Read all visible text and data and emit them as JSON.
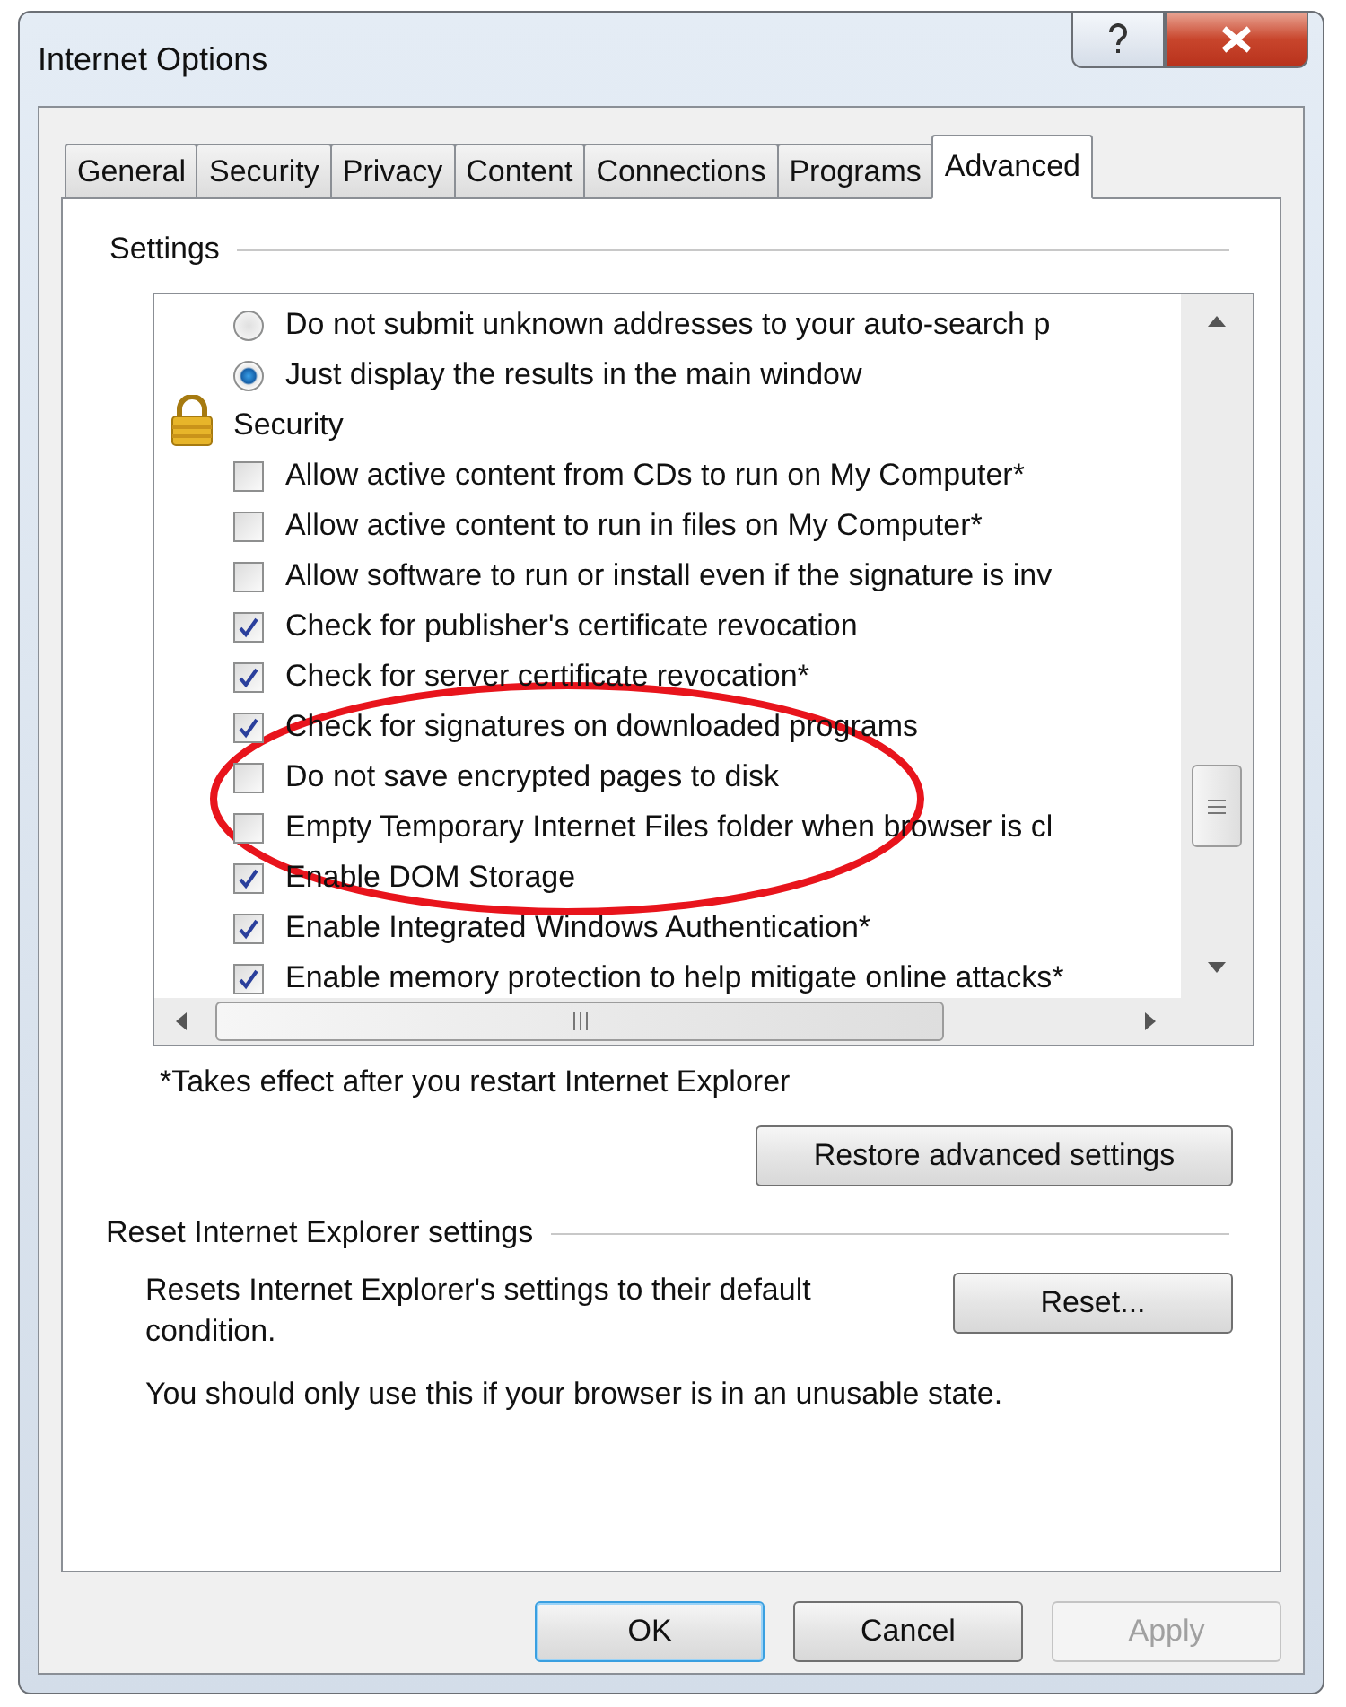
{
  "window": {
    "title": "Internet Options"
  },
  "tabs": [
    {
      "label": "General",
      "selected": false
    },
    {
      "label": "Security",
      "selected": false
    },
    {
      "label": "Privacy",
      "selected": false
    },
    {
      "label": "Content",
      "selected": false
    },
    {
      "label": "Connections",
      "selected": false
    },
    {
      "label": "Programs",
      "selected": false
    },
    {
      "label": "Advanced",
      "selected": true
    }
  ],
  "settings": {
    "label": "Settings",
    "rows": [
      {
        "kind": "radio",
        "label": "Do not submit unknown addresses to your auto-search p",
        "selected": false
      },
      {
        "kind": "radio",
        "label": "Just display the results in the main window",
        "selected": true
      },
      {
        "kind": "category",
        "label": "Security"
      },
      {
        "kind": "checkbox",
        "label": "Allow active content from CDs to run on My Computer*",
        "checked": false
      },
      {
        "kind": "checkbox",
        "label": "Allow active content to run in files on My Computer*",
        "checked": false
      },
      {
        "kind": "checkbox",
        "label": "Allow software to run or install even if the signature is inv",
        "checked": false
      },
      {
        "kind": "checkbox",
        "label": "Check for publisher's certificate revocation",
        "checked": true
      },
      {
        "kind": "checkbox",
        "label": "Check for server certificate revocation*",
        "checked": true
      },
      {
        "kind": "checkbox",
        "label": "Check for signatures on downloaded programs",
        "checked": true
      },
      {
        "kind": "checkbox",
        "label": "Do not save encrypted pages to disk",
        "checked": false
      },
      {
        "kind": "checkbox",
        "label": "Empty Temporary Internet Files folder when browser is cl",
        "checked": false
      },
      {
        "kind": "checkbox",
        "label": "Enable DOM Storage",
        "checked": true
      },
      {
        "kind": "checkbox",
        "label": "Enable Integrated Windows Authentication*",
        "checked": true
      },
      {
        "kind": "checkbox",
        "label": "Enable memory protection to help mitigate online attacks*",
        "checked": true
      }
    ],
    "note": "*Takes effect after you restart Internet Explorer",
    "restore_button": "Restore advanced settings"
  },
  "reset": {
    "label": "Reset Internet Explorer settings",
    "description": "Resets Internet Explorer's settings to their default condition.",
    "button": "Reset...",
    "warning": "You should only use this if your browser is in an unusable state."
  },
  "buttons": [
    {
      "label": "OK",
      "default": true,
      "disabled": false
    },
    {
      "label": "Cancel",
      "default": false,
      "disabled": false
    },
    {
      "label": "Apply",
      "default": false,
      "disabled": true
    }
  ]
}
